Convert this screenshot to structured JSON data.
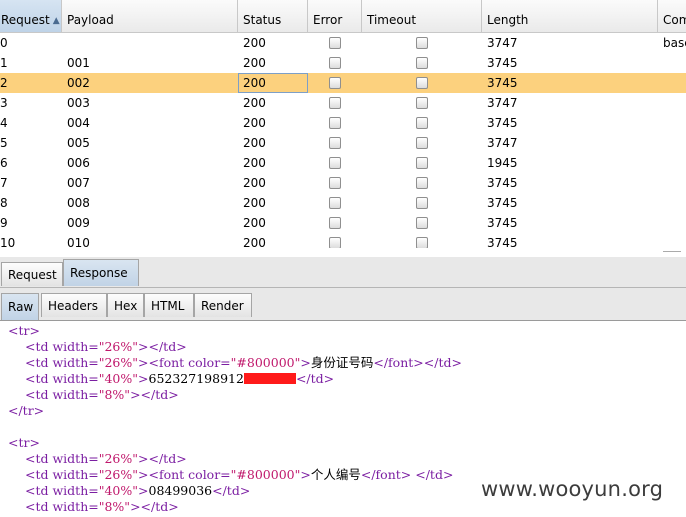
{
  "table": {
    "columns": [
      "Request",
      "Payload",
      "Status",
      "Error",
      "Timeout",
      "Length",
      "Com"
    ],
    "sorted_column": "Request",
    "rows": [
      {
        "request": "0",
        "payload": "",
        "status": "200",
        "error": false,
        "timeout": false,
        "length": "3747",
        "comment": "base"
      },
      {
        "request": "1",
        "payload": "001",
        "status": "200",
        "error": false,
        "timeout": false,
        "length": "3745",
        "comment": ""
      },
      {
        "request": "2",
        "payload": "002",
        "status": "200",
        "error": false,
        "timeout": false,
        "length": "3745",
        "comment": ""
      },
      {
        "request": "3",
        "payload": "003",
        "status": "200",
        "error": false,
        "timeout": false,
        "length": "3747",
        "comment": ""
      },
      {
        "request": "4",
        "payload": "004",
        "status": "200",
        "error": false,
        "timeout": false,
        "length": "3745",
        "comment": ""
      },
      {
        "request": "5",
        "payload": "005",
        "status": "200",
        "error": false,
        "timeout": false,
        "length": "3747",
        "comment": ""
      },
      {
        "request": "6",
        "payload": "006",
        "status": "200",
        "error": false,
        "timeout": false,
        "length": "1945",
        "comment": ""
      },
      {
        "request": "7",
        "payload": "007",
        "status": "200",
        "error": false,
        "timeout": false,
        "length": "3745",
        "comment": ""
      },
      {
        "request": "8",
        "payload": "008",
        "status": "200",
        "error": false,
        "timeout": false,
        "length": "3745",
        "comment": ""
      },
      {
        "request": "9",
        "payload": "009",
        "status": "200",
        "error": false,
        "timeout": false,
        "length": "3745",
        "comment": ""
      },
      {
        "request": "10",
        "payload": "010",
        "status": "200",
        "error": false,
        "timeout": false,
        "length": "3745",
        "comment": ""
      }
    ],
    "selected_row": "2"
  },
  "tabs_outer": [
    "Request",
    "Response"
  ],
  "tabs_outer_active": "Response",
  "tabs_inner": [
    "Raw",
    "Headers",
    "Hex",
    "HTML",
    "Render"
  ],
  "tabs_inner_active": "Raw",
  "response_lines": {
    "l1": "<tr>",
    "l2_attr": "<td width=",
    "l2_val": "\"26%\"",
    "l2_end": "></td>",
    "l3_attr": "<td width=",
    "l3_val": "\"26%\"",
    "l3_font": "><font color=",
    "l3_color": "\"#800000\"",
    "l3_gt": ">",
    "l3_text": "身份证号码",
    "l3_end": "</font></td>",
    "l4_attr": "<td width=",
    "l4_val": "\"40%\"",
    "l4_gt": ">",
    "l4_text": "652327198912",
    "l4_end": "</td>",
    "l5_attr": "<td width=",
    "l5_val": "\"8%\"",
    "l5_end": "></td>",
    "l6": "</tr>",
    "l7": "<tr>",
    "l8_attr": "<td width=",
    "l8_val": "\"26%\"",
    "l8_end": "></td>",
    "l9_attr": "<td width=",
    "l9_val": "\"26%\"",
    "l9_font": "><font color=",
    "l9_color": "\"#800000\"",
    "l9_gt": ">",
    "l9_text": "个人编号",
    "l9_end": "</font> </td>",
    "l10_attr": "<td width=",
    "l10_val": "\"40%\"",
    "l10_gt": ">",
    "l10_text": "08499036",
    "l10_end": "</td>",
    "l11_attr": "<td width=",
    "l11_val": "\"8%\"",
    "l11_end": "></td>"
  },
  "watermark": "www.wooyun.org",
  "colors": {
    "selected_row": "#fcd17e",
    "tag": "#7b1ea2",
    "value": "#c0186c",
    "redaction": "#ff1a1a"
  }
}
